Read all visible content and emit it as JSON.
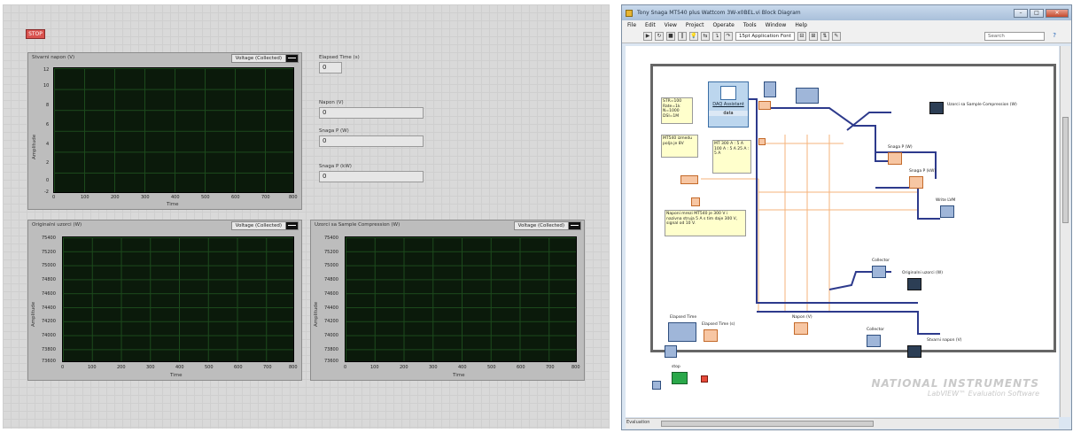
{
  "front_panel": {
    "stop_label": "STOP",
    "graph1": {
      "title": "Stvarni napon (V)",
      "legend": "Voltage (Collected)",
      "ylabel": "Amplitude",
      "xlabel": "Time",
      "yticks": [
        "12",
        "10",
        "8",
        "6",
        "4",
        "2",
        "0",
        "-2"
      ],
      "xticks": [
        "0",
        "100",
        "200",
        "300",
        "400",
        "500",
        "600",
        "700",
        "800"
      ]
    },
    "graph2": {
      "title": "Originalni uzorci (W)",
      "legend": "Voltage (Collected)",
      "ylabel": "Amplitude",
      "xlabel": "Time",
      "yticks": [
        "75400",
        "75200",
        "75000",
        "74800",
        "74600",
        "74400",
        "74200",
        "74000",
        "73800",
        "73600"
      ],
      "xticks": [
        "0",
        "100",
        "200",
        "300",
        "400",
        "500",
        "600",
        "700",
        "800"
      ]
    },
    "graph3": {
      "title": "Uzorci sa Sample Compression (W)",
      "legend": "Voltage (Collected)",
      "ylabel": "Amplitude",
      "xlabel": "Time",
      "yticks": [
        "75400",
        "75200",
        "75000",
        "74800",
        "74600",
        "74400",
        "74200",
        "74000",
        "73800",
        "73600"
      ],
      "xticks": [
        "0",
        "100",
        "200",
        "300",
        "400",
        "500",
        "600",
        "700",
        "800"
      ]
    },
    "elapsed_time": {
      "label": "Elapsed Time (s)",
      "value": "0"
    },
    "napon": {
      "label": "Napon (V)",
      "value": "0"
    },
    "snaga_p": {
      "label": "Snaga P (W)",
      "value": "0"
    },
    "snaga_p_kw": {
      "label": "Snaga P (kW)",
      "value": "0"
    }
  },
  "block_diagram": {
    "title": "Tony Snaga MT540 plus Wattcom 3W-x0BEL.vi Block Diagram",
    "menu": [
      "File",
      "Edit",
      "View",
      "Project",
      "Operate",
      "Tools",
      "Window",
      "Help"
    ],
    "font_selector": "15pt Application Font",
    "search_placeholder": "Search",
    "status": "Evaluation",
    "daq": {
      "label": "DAQ Assistant",
      "out": "data"
    },
    "labels": {
      "compression": "Uzorci sa Sample Compression (W)",
      "snaga_p": "Snaga P (W)",
      "snaga_p_kw": "Snaga P (kW)",
      "write_lvm": "Write LVM",
      "collector1": "Collector",
      "orig": "Originalni uzorci (W)",
      "napon": "Napon (V)",
      "collector2": "Collector",
      "stvarni": "Stvarni napon (V)",
      "elapsed": "Elapsed Time",
      "elapsed_s": "Elapsed Time (s)",
      "stop": "stop"
    },
    "notes": {
      "note1": "STR=100 Rate=1k N=1000 DSI=1M",
      "note2": "MT540 izmedu polja je 8V",
      "note3": "MT 300 A : 5 A 100 A : 5 A 25 A : 5 A",
      "note4": "Naponi mrezi MT540 je 300 V i nazivna struja 5 A s tim daje 300 V, signal od 10 V."
    },
    "watermark": {
      "line1": "NATIONAL INSTRUMENTS",
      "line2": "LabVIEW™ Evaluation Software"
    }
  }
}
